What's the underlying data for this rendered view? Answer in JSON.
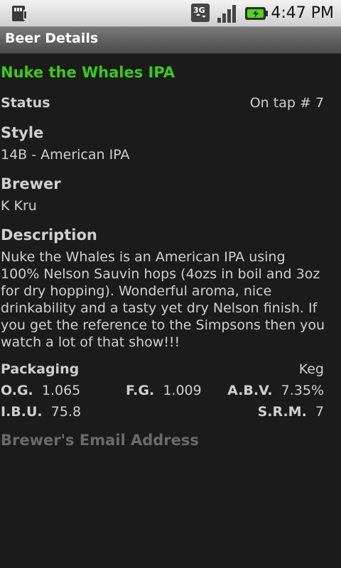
{
  "status_bar": {
    "time": "4:47 PM",
    "network_label": "3G",
    "icons": [
      "sd-card-icon",
      "3g-data-icon",
      "signal-strength-icon",
      "battery-charging-icon"
    ]
  },
  "header": {
    "title": "Beer Details"
  },
  "beer": {
    "name": "Nuke the Whales IPA",
    "status_label": "Status",
    "status_value": "On tap # 7",
    "style_heading": "Style",
    "style_value": "14B - American IPA",
    "brewer_heading": "Brewer",
    "brewer_value": "K Kru",
    "description_heading": "Description",
    "description": "Nuke the Whales is an American IPA using 100% Nelson Sauvin hops (4ozs in boil and 3oz for dry hopping). Wonderful aroma, nice drinkability and a tasty yet dry Nelson finish.  If you get the reference to the Simpsons then you watch a lot of that show!!!",
    "packaging_label": "Packaging",
    "packaging_value": "Keg",
    "og_label": "O.G.",
    "og_value": "1.065",
    "fg_label": "F.G.",
    "fg_value": "1.009",
    "abv_label": "A.B.V.",
    "abv_value": "7.35%",
    "ibu_label": "I.B.U.",
    "ibu_value": "75.8",
    "srm_label": "S.R.M.",
    "srm_value": "7",
    "email_link": "Brewer's Email Address"
  },
  "colors": {
    "beer_name": "#3dc81f",
    "background": "#1b1b1b",
    "email_link": "#6a6a6a"
  }
}
